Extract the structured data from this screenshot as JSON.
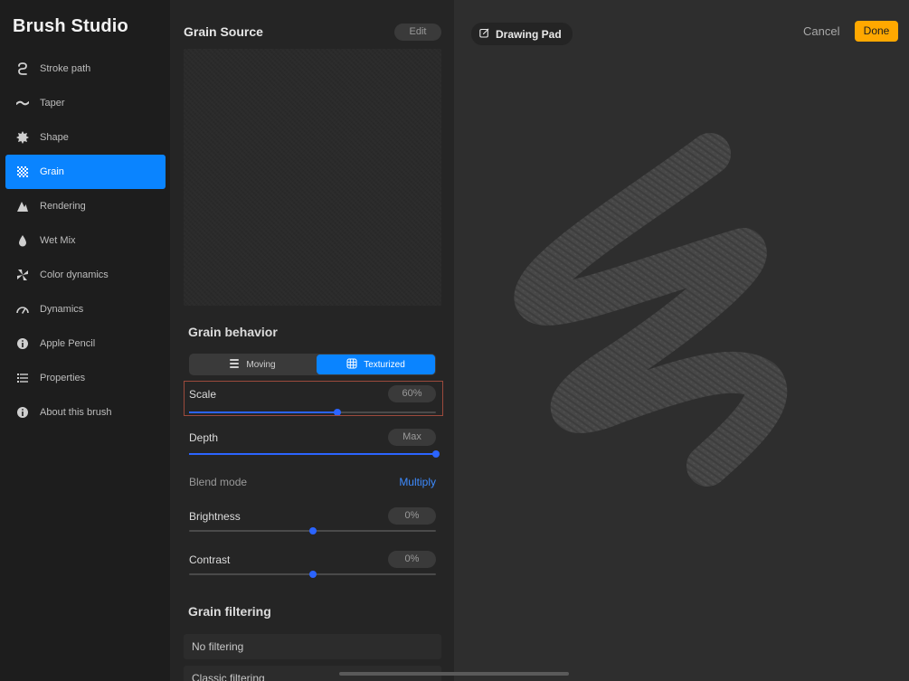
{
  "sidebar": {
    "title": "Brush Studio",
    "items": [
      {
        "label": "Stroke path",
        "icon": "stroke-path-icon"
      },
      {
        "label": "Taper",
        "icon": "taper-icon"
      },
      {
        "label": "Shape",
        "icon": "shape-icon"
      },
      {
        "label": "Grain",
        "icon": "grain-icon",
        "active": true
      },
      {
        "label": "Rendering",
        "icon": "rendering-icon"
      },
      {
        "label": "Wet Mix",
        "icon": "wet-mix-icon"
      },
      {
        "label": "Color dynamics",
        "icon": "color-dynamics-icon"
      },
      {
        "label": "Dynamics",
        "icon": "dynamics-icon"
      },
      {
        "label": "Apple Pencil",
        "icon": "apple-pencil-icon"
      },
      {
        "label": "Properties",
        "icon": "properties-icon"
      },
      {
        "label": "About this brush",
        "icon": "about-icon"
      }
    ]
  },
  "grain_source": {
    "title": "Grain Source",
    "edit_label": "Edit"
  },
  "grain_behavior": {
    "title": "Grain behavior",
    "modes": {
      "moving": "Moving",
      "texturized": "Texturized",
      "selected": "Texturized"
    },
    "scale": {
      "label": "Scale",
      "value": "60%",
      "level": 0.6
    },
    "depth": {
      "label": "Depth",
      "value": "Max",
      "level": 1.0
    },
    "blend_mode": {
      "label": "Blend mode",
      "value": "Multiply"
    },
    "brightness": {
      "label": "Brightness",
      "value": "0%",
      "level": 0.5
    },
    "contrast": {
      "label": "Contrast",
      "value": "0%",
      "level": 0.5
    }
  },
  "grain_filtering": {
    "title": "Grain filtering",
    "options": [
      "No filtering",
      "Classic filtering"
    ]
  },
  "drawing_pad": {
    "title": "Drawing Pad",
    "cancel_label": "Cancel",
    "done_label": "Done"
  },
  "colors": {
    "accent": "#0a84ff",
    "slider": "#2b64ff",
    "done": "#ffa800",
    "highlight": "#9c4a3c",
    "link": "#3d8bff"
  }
}
